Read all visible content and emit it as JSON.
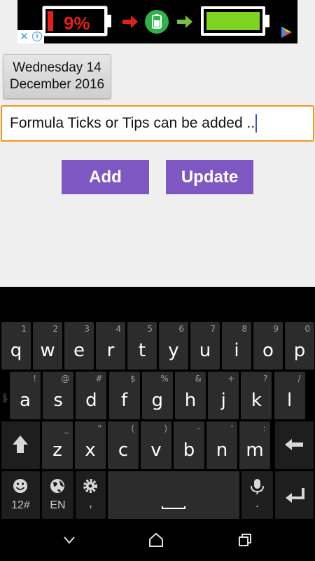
{
  "ad": {
    "battery_low_text": "9%",
    "close_glyph": "✕",
    "info_glyph": "i"
  },
  "date_button": {
    "line1": "Wednesday 14",
    "line2": "December 2016"
  },
  "text_field": {
    "value": "Formula Ticks or Tips can be added .."
  },
  "buttons": {
    "add": "Add",
    "update": "Update"
  },
  "keyboard": {
    "row1": [
      {
        "letter": "q",
        "hint": "1"
      },
      {
        "letter": "w",
        "hint": "2"
      },
      {
        "letter": "e",
        "hint": "3"
      },
      {
        "letter": "r",
        "hint": "4"
      },
      {
        "letter": "t",
        "hint": "5"
      },
      {
        "letter": "y",
        "hint": "6"
      },
      {
        "letter": "u",
        "hint": "7"
      },
      {
        "letter": "i",
        "hint": "8"
      },
      {
        "letter": "o",
        "hint": "9"
      },
      {
        "letter": "p",
        "hint": "0"
      }
    ],
    "row2": [
      {
        "letter": "a",
        "hint": "!"
      },
      {
        "letter": "s",
        "hint": "@"
      },
      {
        "letter": "d",
        "hint": "#"
      },
      {
        "letter": "f",
        "hint": "$"
      },
      {
        "letter": "g",
        "hint": "%"
      },
      {
        "letter": "h",
        "hint": "&"
      },
      {
        "letter": "j",
        "hint": "+"
      },
      {
        "letter": "k",
        "hint": "?"
      },
      {
        "letter": "l",
        "hint": "/"
      }
    ],
    "row3": [
      {
        "letter": "z",
        "hint": "_"
      },
      {
        "letter": "x",
        "hint": "\""
      },
      {
        "letter": "c",
        "hint": "("
      },
      {
        "letter": "v",
        "hint": ")"
      },
      {
        "letter": "b",
        "hint": "-"
      },
      {
        "letter": "n",
        "hint": "'"
      },
      {
        "letter": "m",
        "hint": ":"
      }
    ],
    "symbols_label": "12#",
    "language_label": "EN",
    "settings_hint": ",",
    "mic_hint": ".",
    "side_label": "sym"
  },
  "colors": {
    "accent_orange": "#f7941d",
    "button_purple": "#7e57c2",
    "keyboard_bg": "#000000",
    "key_bg": "#2c2c2c"
  }
}
